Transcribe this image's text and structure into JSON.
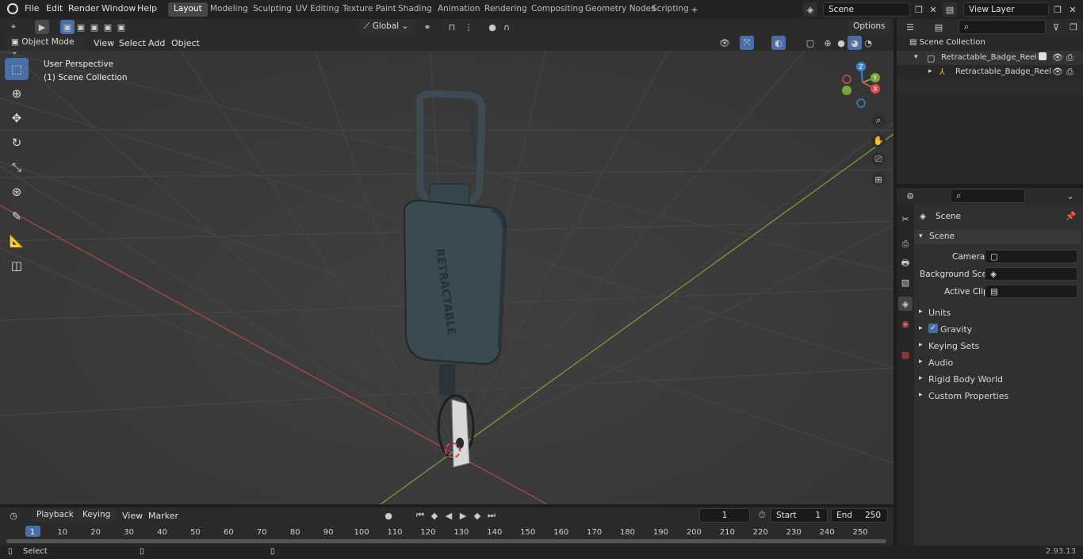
{
  "menus": [
    "File",
    "Edit",
    "Render",
    "Window",
    "Help"
  ],
  "workspaces": [
    "Layout",
    "Modeling",
    "Sculpting",
    "UV Editing",
    "Texture Paint",
    "Shading",
    "Animation",
    "Rendering",
    "Compositing",
    "Geometry Nodes",
    "Scripting"
  ],
  "active_workspace": "Layout",
  "scene_field": "Scene",
  "view_layer_field": "View Layer",
  "viewport_header": {
    "mode": "Object Mode",
    "menus": [
      "View",
      "Select",
      "Add",
      "Object"
    ],
    "orientation": "Global",
    "options": "Options"
  },
  "viewport": {
    "perspective_label": "User Perspective",
    "collection_label": "(1) Scene Collection",
    "model_text": "RETRACTABLE"
  },
  "gizmo": {
    "z": "Z",
    "y": "Y",
    "x": "X"
  },
  "outliner": {
    "root": "Scene Collection",
    "items": [
      {
        "label": "Retractable_Badge_Reel_Blac"
      },
      {
        "label": "Retractable_Badge_Reel"
      }
    ]
  },
  "properties": {
    "context_title": "Scene",
    "panel_title": "Scene",
    "fields": [
      {
        "label": "Camera"
      },
      {
        "label": "Background Scene"
      },
      {
        "label": "Active Clip"
      }
    ],
    "panels": [
      "Units",
      "Gravity",
      "Keying Sets",
      "Audio",
      "Rigid Body World",
      "Custom Properties"
    ],
    "gravity_checked": true
  },
  "timeline": {
    "menus": [
      "Playback",
      "Keying",
      "View",
      "Marker"
    ],
    "current_frame": "1",
    "start_label": "Start",
    "start_value": "1",
    "end_label": "End",
    "end_value": "250",
    "ticks": [
      "1",
      "10",
      "20",
      "30",
      "40",
      "50",
      "60",
      "70",
      "80",
      "90",
      "100",
      "110",
      "120",
      "130",
      "140",
      "150",
      "160",
      "170",
      "180",
      "190",
      "200",
      "210",
      "220",
      "230",
      "240",
      "250"
    ]
  },
  "status": {
    "left": "Select",
    "version": "2.93.13"
  },
  "colors": {
    "accent": "#4a6fa8",
    "x_axis": "#b24a4a",
    "y_axis": "#7aa53a",
    "z_axis": "#3d7fd6"
  }
}
